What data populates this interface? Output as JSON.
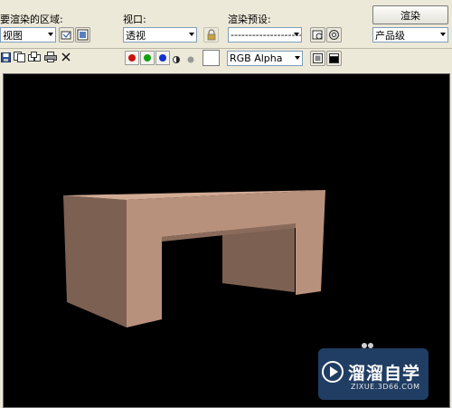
{
  "labels": {
    "area_to_render": "要渲染的区域:",
    "viewport": "视口:",
    "render_preset": "渲染预设:"
  },
  "combos": {
    "area": "视图",
    "viewport": "透视",
    "preset": "---------------------------",
    "quality": "产品级",
    "channel": "RGB Alpha"
  },
  "buttons": {
    "render": "渲染"
  },
  "watermark": {
    "text": "溜溜自学",
    "url": "ZIXUE.3D66.COM"
  },
  "colors": {
    "red": "#cc1111",
    "green": "#11a011",
    "blue": "#1131cc",
    "white_swatch": "#ffffff",
    "table_front": "#b8917c",
    "table_top": "#d2ab95",
    "table_side": "#7c6052",
    "watermark_bg": "#3a6fb5"
  },
  "icons": [
    "region-select-icon",
    "region-auto-icon",
    "lock-icon",
    "preset-load-icon",
    "preset-settings-icon",
    "save-icon",
    "copy-icon",
    "clone-icon",
    "print-icon",
    "close-icon",
    "mono-icon",
    "alpha-icon",
    "display-icon",
    "alpha-display-icon"
  ]
}
